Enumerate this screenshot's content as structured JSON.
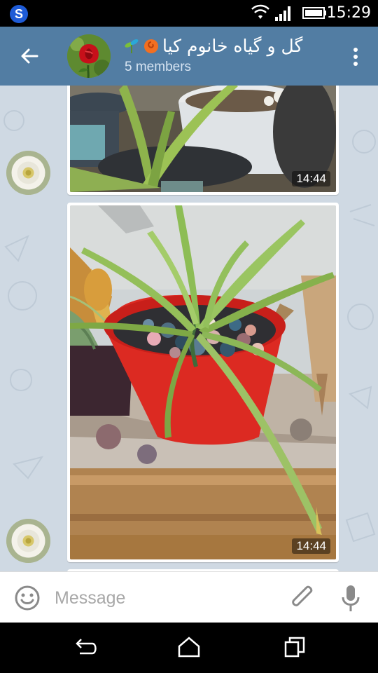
{
  "status_bar": {
    "time": "15:29",
    "icons": [
      "app-s-icon",
      "wifi-icon",
      "signal-icon",
      "battery-icon"
    ]
  },
  "header": {
    "title": "گل و گیاه خانوم کیا",
    "title_emoji": [
      "sprout-emoji",
      "rose-emoji"
    ],
    "subtitle": "5 members",
    "back_icon": "arrow-left-icon",
    "menu_icon": "more-vertical-icon",
    "background": "#527da3"
  },
  "chat": {
    "background": "#cfd9e3",
    "messages": [
      {
        "type": "photo",
        "time": "14:44",
        "sender_avatar": "white-flower-avatar",
        "content": "aloe-plant-photo"
      },
      {
        "type": "photo",
        "time": "14:44",
        "sender_avatar": "white-flower-avatar",
        "content": "aloe-red-pot-photo"
      }
    ]
  },
  "input_bar": {
    "placeholder": "Message",
    "emoji_icon": "smiley-icon",
    "attach_icon": "paperclip-icon",
    "mic_icon": "microphone-icon"
  },
  "nav_bar": {
    "icons": [
      "back-nav-icon",
      "home-nav-icon",
      "recents-nav-icon"
    ]
  }
}
